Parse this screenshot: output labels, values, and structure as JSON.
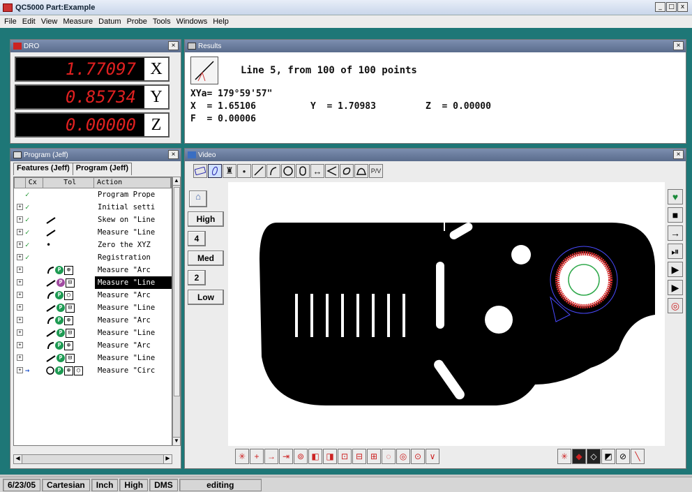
{
  "app": {
    "title": "QC5000 Part:Example",
    "window_controls": [
      "_",
      "□",
      "x"
    ]
  },
  "menu": [
    "File",
    "Edit",
    "View",
    "Measure",
    "Datum",
    "Probe",
    "Tools",
    "Windows",
    "Help"
  ],
  "dro": {
    "title": "DRO",
    "rows": [
      {
        "value": "1.77097",
        "axis": "X"
      },
      {
        "value": "0.85734",
        "axis": "Y"
      },
      {
        "value": "0.00000",
        "axis": "Z"
      }
    ]
  },
  "results": {
    "title": "Results",
    "heading": "Line 5, from 100 of 100 points",
    "xya": "XYa= 179°59'57\"",
    "x": "X  = 1.65106",
    "y": "Y  = 1.70983",
    "z": "Z  = 0.00000",
    "f": "F  = 0.00006"
  },
  "program": {
    "title": "Program (Jeff)",
    "tabs": [
      "Features (Jeff)",
      "Program (Jeff)"
    ],
    "columns": [
      "Cx",
      "Tol",
      "Action"
    ],
    "rows": [
      {
        "action": "Program Prope",
        "check": "✓",
        "icons": ""
      },
      {
        "action": "Initial setti",
        "check": "✓",
        "icons": ""
      },
      {
        "action": "Skew on \"Line",
        "check": "✓",
        "icons": "line"
      },
      {
        "action": "Measure \"Line",
        "check": "✓",
        "icons": "line"
      },
      {
        "action": "Zero the XYZ",
        "check": "✓",
        "icons": "dot"
      },
      {
        "action": "Registration",
        "check": "✓",
        "icons": ""
      },
      {
        "action": "Measure \"Arc",
        "check": "",
        "icons": "arc-p-pos"
      },
      {
        "action": "Measure \"Line",
        "check": "",
        "icons": "line-p-flat",
        "selected": true
      },
      {
        "action": "Measure \"Arc",
        "check": "",
        "icons": "arc-p-circ"
      },
      {
        "action": "Measure \"Line",
        "check": "",
        "icons": "line-p-flat"
      },
      {
        "action": "Measure \"Arc",
        "check": "",
        "icons": "arc-p-pos"
      },
      {
        "action": "Measure \"Line",
        "check": "",
        "icons": "line-p-flat"
      },
      {
        "action": "Measure \"Arc",
        "check": "",
        "icons": "arc-p-pos"
      },
      {
        "action": "Measure \"Line",
        "check": "",
        "icons": "line-p-flat"
      },
      {
        "action": "Measure \"Circ",
        "check": "→",
        "icons": "circ-p-pos-circ"
      }
    ]
  },
  "video": {
    "title": "Video",
    "lighting": [
      "High",
      "4",
      "Med",
      "2",
      "Low"
    ]
  },
  "status": [
    "6/23/05",
    "Cartesian",
    "Inch",
    "High",
    "DMS",
    "editing"
  ]
}
